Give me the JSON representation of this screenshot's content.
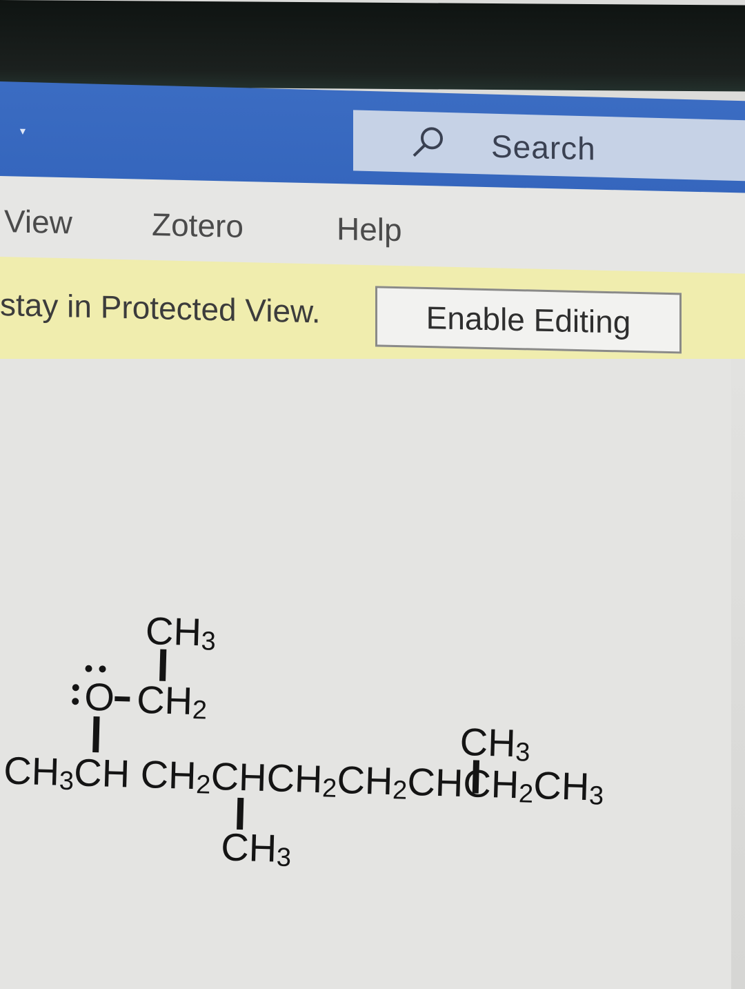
{
  "ribbon": {
    "search_placeholder": "Search",
    "tabs": [
      "View",
      "Zotero",
      "Help"
    ]
  },
  "protected_view": {
    "message": "stay in Protected View.",
    "enable_button": "Enable Editing"
  },
  "molecule": {
    "top_ch3": "CH",
    "top_ch3_sub": "3",
    "oxygen": "O",
    "ethyl_ch2": "CH",
    "ethyl_ch2_sub": "2",
    "branch_ch3_right": "CH",
    "branch_ch3_right_sub": "3",
    "main_chain": [
      {
        "text": "CH",
        "sub": "3"
      },
      {
        "text": "CH",
        "sub": ""
      },
      {
        "text": "CH",
        "sub": "2"
      },
      {
        "text": "CH",
        "sub": ""
      },
      {
        "text": "CH",
        "sub": "2"
      },
      {
        "text": "CH",
        "sub": "2"
      },
      {
        "text": "CH",
        "sub": ""
      },
      {
        "text": "CH",
        "sub": "2"
      },
      {
        "text": "CH",
        "sub": "3"
      }
    ],
    "bottom_ch3": "CH",
    "bottom_ch3_sub": "3"
  },
  "colors": {
    "title_bar": "#3566bd",
    "protected_bar": "#f0edae",
    "ribbon": "#e6e6e4"
  }
}
